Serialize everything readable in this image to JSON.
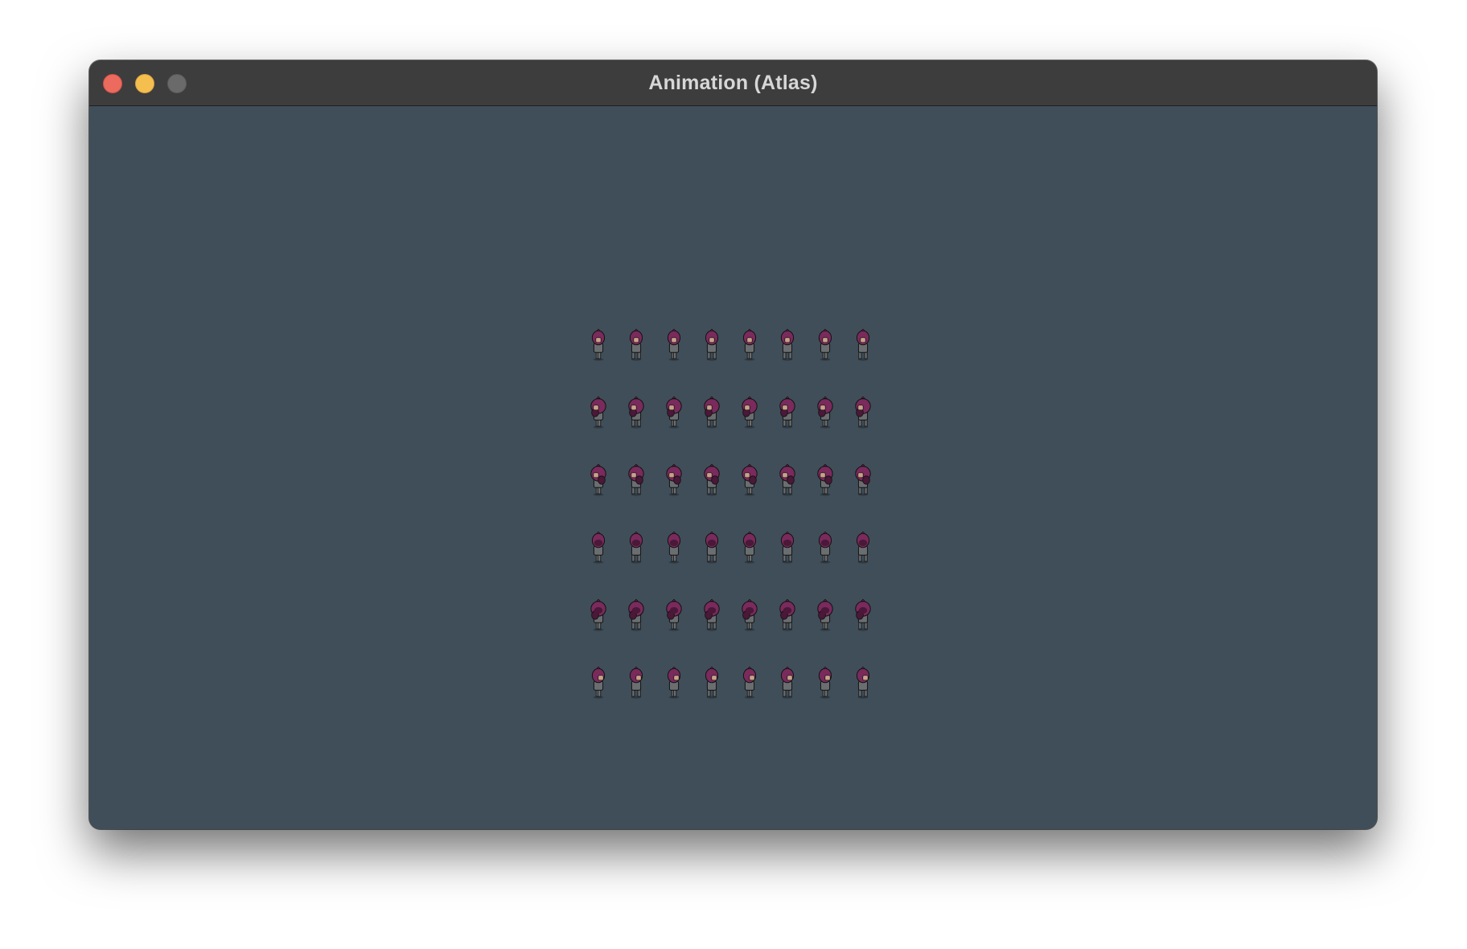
{
  "window": {
    "title": "Animation (Atlas)"
  },
  "traffic_lights": {
    "close": "close-button",
    "minimize": "minimize-button",
    "maximize": "maximize-button"
  },
  "colors": {
    "canvas_background": "#404e59",
    "titlebar": "#3d3d3d",
    "sprite_hair": "#7a2a5c",
    "sprite_hair_shadow": "#4a1838",
    "sprite_skin": "#c9a18a",
    "sprite_outfit": "#6a6e70"
  },
  "sprite_atlas": {
    "rows": 6,
    "columns": 8,
    "row_directions": [
      "down",
      "down-left",
      "left",
      "up",
      "up-right",
      "right"
    ]
  }
}
